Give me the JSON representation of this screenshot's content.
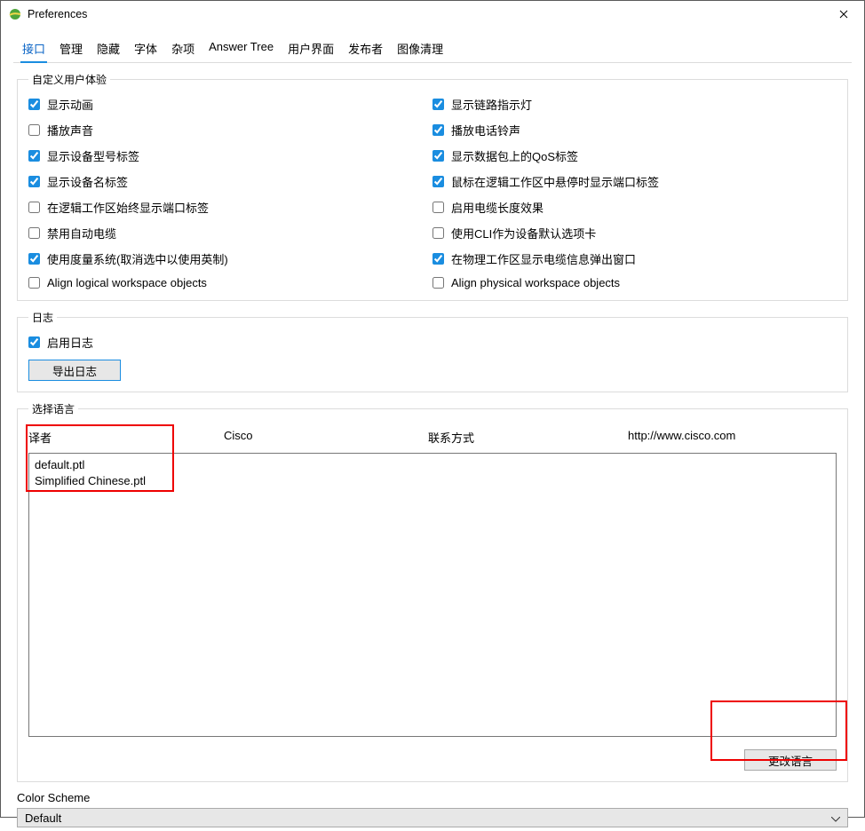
{
  "window": {
    "title": "Preferences"
  },
  "tabs": [
    "接口",
    "管理",
    "隐藏",
    "字体",
    "杂项",
    "Answer Tree",
    "用户界面",
    "发布者",
    "图像清理"
  ],
  "active_tab_index": 0,
  "groups": {
    "customize": {
      "legend": "自定义用户体验",
      "left": [
        {
          "label": "显示动画",
          "checked": true
        },
        {
          "label": "播放声音",
          "checked": false
        },
        {
          "label": "显示设备型号标签",
          "checked": true
        },
        {
          "label": "显示设备名标签",
          "checked": true
        },
        {
          "label": "在逻辑工作区始终显示端口标签",
          "checked": false
        },
        {
          "label": "禁用自动电缆",
          "checked": false
        },
        {
          "label": "使用度量系统(取消选中以使用英制)",
          "checked": true
        },
        {
          "label": "Align logical workspace objects",
          "checked": false
        }
      ],
      "right": [
        {
          "label": "显示链路指示灯",
          "checked": true
        },
        {
          "label": "播放电话铃声",
          "checked": true
        },
        {
          "label": "显示数据包上的QoS标签",
          "checked": true
        },
        {
          "label": "鼠标在逻辑工作区中悬停时显示端口标签",
          "checked": true
        },
        {
          "label": "启用电缆长度效果",
          "checked": false
        },
        {
          "label": "使用CLI作为设备默认选项卡",
          "checked": false
        },
        {
          "label": "在物理工作区显示电缆信息弹出窗口",
          "checked": true
        },
        {
          "label": "Align physical workspace objects",
          "checked": false
        }
      ]
    },
    "log": {
      "legend": "日志",
      "enable_label": "启用日志",
      "enable_checked": true,
      "export_label": "导出日志"
    },
    "language": {
      "legend": "选择语言",
      "translator_label": "译者",
      "vendor": "Cisco",
      "contact_label": "联系方式",
      "contact_value": "http://www.cisco.com",
      "items": [
        "default.ptl",
        "Simplified Chinese.ptl"
      ],
      "change_label": "更改语言"
    }
  },
  "color_scheme": {
    "label": "Color Scheme",
    "value": "Default"
  }
}
